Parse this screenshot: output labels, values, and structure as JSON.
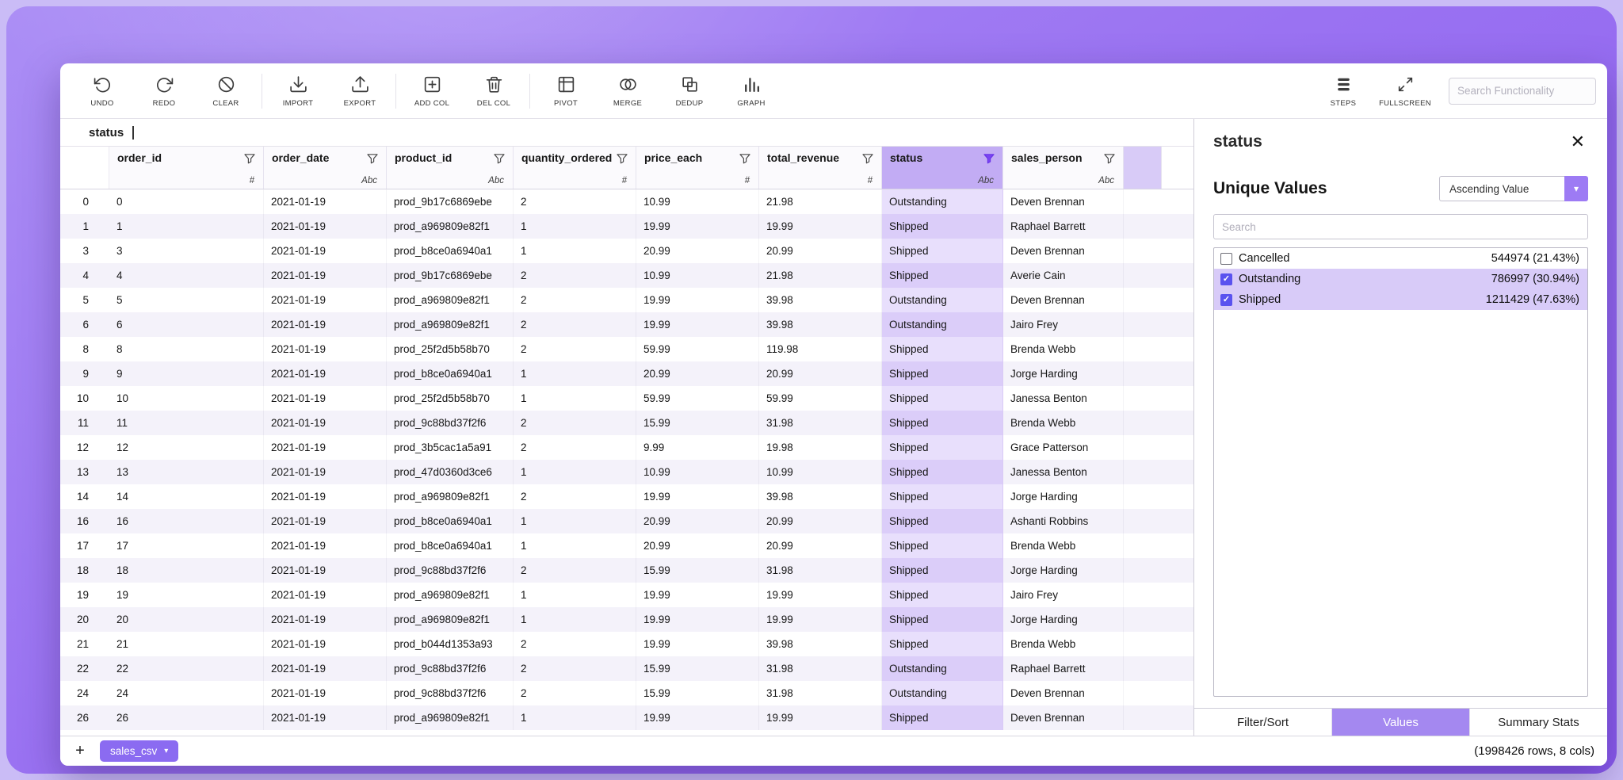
{
  "colors": {
    "accent": "#9d7bf4",
    "accent_dark": "#5a52ef",
    "filtered_header": "#c2acf4",
    "selected_row": "#d8cbf8",
    "background_purple": "#9a72f2"
  },
  "icons": {
    "close": "✕",
    "caret-down": "▾",
    "plus": "+",
    "check": "✓"
  },
  "toolbar": {
    "groups": [
      {
        "items": [
          {
            "icon": "undo-icon",
            "label": "UNDO"
          },
          {
            "icon": "redo-icon",
            "label": "REDO"
          },
          {
            "icon": "clear-icon",
            "label": "CLEAR"
          }
        ]
      },
      {
        "items": [
          {
            "icon": "import-icon",
            "label": "IMPORT"
          },
          {
            "icon": "export-icon",
            "label": "EXPORT"
          }
        ]
      },
      {
        "items": [
          {
            "icon": "add-col-icon",
            "label": "ADD COL"
          },
          {
            "icon": "del-col-icon",
            "label": "DEL COL"
          }
        ]
      },
      {
        "items": [
          {
            "icon": "pivot-icon",
            "label": "PIVOT"
          },
          {
            "icon": "merge-icon",
            "label": "MERGE"
          },
          {
            "icon": "dedup-icon",
            "label": "DEDUP"
          },
          {
            "icon": "graph-icon",
            "label": "GRAPH"
          }
        ]
      }
    ],
    "right_buttons": [
      {
        "icon": "steps-icon",
        "label": "STEPS"
      },
      {
        "icon": "fullscreen-icon",
        "label": "FULLSCREEN"
      }
    ],
    "search_placeholder": "Search Functionality"
  },
  "formula_bar": {
    "value": "status"
  },
  "table": {
    "columns": [
      {
        "name": "order_id",
        "type": "#",
        "filtered": false
      },
      {
        "name": "order_date",
        "type": "Abc",
        "filtered": false
      },
      {
        "name": "product_id",
        "type": "Abc",
        "filtered": false
      },
      {
        "name": "quantity_ordered",
        "type": "#",
        "filtered": false
      },
      {
        "name": "price_each",
        "type": "#",
        "filtered": false
      },
      {
        "name": "total_revenue",
        "type": "#",
        "filtered": false
      },
      {
        "name": "status",
        "type": "Abc",
        "filtered": true
      },
      {
        "name": "sales_person",
        "type": "Abc",
        "filtered": false
      }
    ],
    "rows": [
      {
        "index": "0",
        "cells": [
          "0",
          "2021-01-19",
          "prod_9b17c6869ebe",
          "2",
          "10.99",
          "21.98",
          "Outstanding",
          "Deven Brennan"
        ]
      },
      {
        "index": "1",
        "cells": [
          "1",
          "2021-01-19",
          "prod_a969809e82f1",
          "1",
          "19.99",
          "19.99",
          "Shipped",
          "Raphael Barrett"
        ]
      },
      {
        "index": "3",
        "cells": [
          "3",
          "2021-01-19",
          "prod_b8ce0a6940a1",
          "1",
          "20.99",
          "20.99",
          "Shipped",
          "Deven Brennan"
        ]
      },
      {
        "index": "4",
        "cells": [
          "4",
          "2021-01-19",
          "prod_9b17c6869ebe",
          "2",
          "10.99",
          "21.98",
          "Shipped",
          "Averie Cain"
        ]
      },
      {
        "index": "5",
        "cells": [
          "5",
          "2021-01-19",
          "prod_a969809e82f1",
          "2",
          "19.99",
          "39.98",
          "Outstanding",
          "Deven Brennan"
        ]
      },
      {
        "index": "6",
        "cells": [
          "6",
          "2021-01-19",
          "prod_a969809e82f1",
          "2",
          "19.99",
          "39.98",
          "Outstanding",
          "Jairo Frey"
        ]
      },
      {
        "index": "8",
        "cells": [
          "8",
          "2021-01-19",
          "prod_25f2d5b58b70",
          "2",
          "59.99",
          "119.98",
          "Shipped",
          "Brenda Webb"
        ]
      },
      {
        "index": "9",
        "cells": [
          "9",
          "2021-01-19",
          "prod_b8ce0a6940a1",
          "1",
          "20.99",
          "20.99",
          "Shipped",
          "Jorge Harding"
        ]
      },
      {
        "index": "10",
        "cells": [
          "10",
          "2021-01-19",
          "prod_25f2d5b58b70",
          "1",
          "59.99",
          "59.99",
          "Shipped",
          "Janessa Benton"
        ]
      },
      {
        "index": "11",
        "cells": [
          "11",
          "2021-01-19",
          "prod_9c88bd37f2f6",
          "2",
          "15.99",
          "31.98",
          "Shipped",
          "Brenda Webb"
        ]
      },
      {
        "index": "12",
        "cells": [
          "12",
          "2021-01-19",
          "prod_3b5cac1a5a91",
          "2",
          "9.99",
          "19.98",
          "Shipped",
          "Grace Patterson"
        ]
      },
      {
        "index": "13",
        "cells": [
          "13",
          "2021-01-19",
          "prod_47d0360d3ce6",
          "1",
          "10.99",
          "10.99",
          "Shipped",
          "Janessa Benton"
        ]
      },
      {
        "index": "14",
        "cells": [
          "14",
          "2021-01-19",
          "prod_a969809e82f1",
          "2",
          "19.99",
          "39.98",
          "Shipped",
          "Jorge Harding"
        ]
      },
      {
        "index": "16",
        "cells": [
          "16",
          "2021-01-19",
          "prod_b8ce0a6940a1",
          "1",
          "20.99",
          "20.99",
          "Shipped",
          "Ashanti Robbins"
        ]
      },
      {
        "index": "17",
        "cells": [
          "17",
          "2021-01-19",
          "prod_b8ce0a6940a1",
          "1",
          "20.99",
          "20.99",
          "Shipped",
          "Brenda Webb"
        ]
      },
      {
        "index": "18",
        "cells": [
          "18",
          "2021-01-19",
          "prod_9c88bd37f2f6",
          "2",
          "15.99",
          "31.98",
          "Shipped",
          "Jorge Harding"
        ]
      },
      {
        "index": "19",
        "cells": [
          "19",
          "2021-01-19",
          "prod_a969809e82f1",
          "1",
          "19.99",
          "19.99",
          "Shipped",
          "Jairo Frey"
        ]
      },
      {
        "index": "20",
        "cells": [
          "20",
          "2021-01-19",
          "prod_a969809e82f1",
          "1",
          "19.99",
          "19.99",
          "Shipped",
          "Jorge Harding"
        ]
      },
      {
        "index": "21",
        "cells": [
          "21",
          "2021-01-19",
          "prod_b044d1353a93",
          "2",
          "19.99",
          "39.98",
          "Shipped",
          "Brenda Webb"
        ]
      },
      {
        "index": "22",
        "cells": [
          "22",
          "2021-01-19",
          "prod_9c88bd37f2f6",
          "2",
          "15.99",
          "31.98",
          "Outstanding",
          "Raphael Barrett"
        ]
      },
      {
        "index": "24",
        "cells": [
          "24",
          "2021-01-19",
          "prod_9c88bd37f2f6",
          "2",
          "15.99",
          "31.98",
          "Outstanding",
          "Deven Brennan"
        ]
      },
      {
        "index": "26",
        "cells": [
          "26",
          "2021-01-19",
          "prod_a969809e82f1",
          "1",
          "19.99",
          "19.99",
          "Shipped",
          "Deven Brennan"
        ]
      }
    ]
  },
  "panel": {
    "title": "status",
    "unique_values_heading": "Unique Values",
    "sort_dropdown_value": "Ascending Value",
    "search_placeholder": "Search",
    "values": [
      {
        "label": "Cancelled",
        "checked": false,
        "count": "544974 (21.43%)"
      },
      {
        "label": "Outstanding",
        "checked": true,
        "count": "786997 (30.94%)"
      },
      {
        "label": "Shipped",
        "checked": true,
        "count": "1211429 (47.63%)"
      }
    ],
    "tabs": [
      {
        "label": "Filter/Sort",
        "active": false
      },
      {
        "label": "Values",
        "active": true
      },
      {
        "label": "Summary Stats",
        "active": false
      }
    ]
  },
  "footer": {
    "sheet_tab": "sales_csv",
    "status_text": "(1998426 rows, 8 cols)"
  }
}
